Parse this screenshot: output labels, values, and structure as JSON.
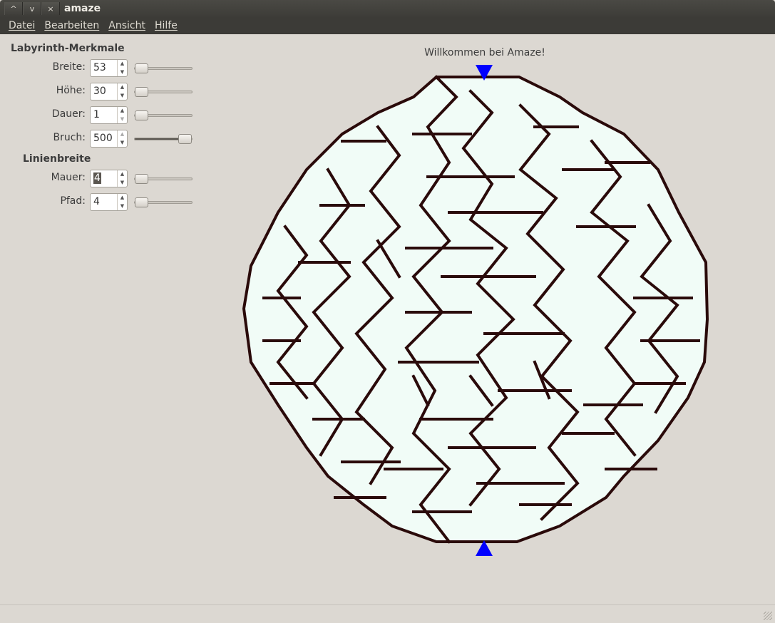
{
  "window": {
    "title": "amaze",
    "buttons": [
      "^",
      "v",
      "×"
    ]
  },
  "menu": [
    "Datei",
    "Bearbeiten",
    "Ansicht",
    "Hilfe"
  ],
  "panel": {
    "section1": "Labyrinth-Merkmale",
    "section2": "Linienbreite",
    "rows": [
      {
        "label": "Breite:",
        "value": "53",
        "slider_fraction": 0.0
      },
      {
        "label": "Höhe:",
        "value": "30",
        "slider_fraction": 0.0
      },
      {
        "label": "Dauer:",
        "value": "1",
        "slider_fraction": 0.0
      },
      {
        "label": "Bruch:",
        "value": "500",
        "slider_fraction": 1.0
      },
      {
        "label": "Mauer:",
        "value": "4",
        "slider_fraction": 0.0
      },
      {
        "label": "Pfad:",
        "value": "4",
        "slider_fraction": 0.0
      }
    ]
  },
  "status": {
    "message": "Willkommen bei Amaze!"
  },
  "colors": {
    "maze_fill": "#f1fcf7",
    "wall": "#2a0a0a",
    "marker": "#0000ff"
  }
}
